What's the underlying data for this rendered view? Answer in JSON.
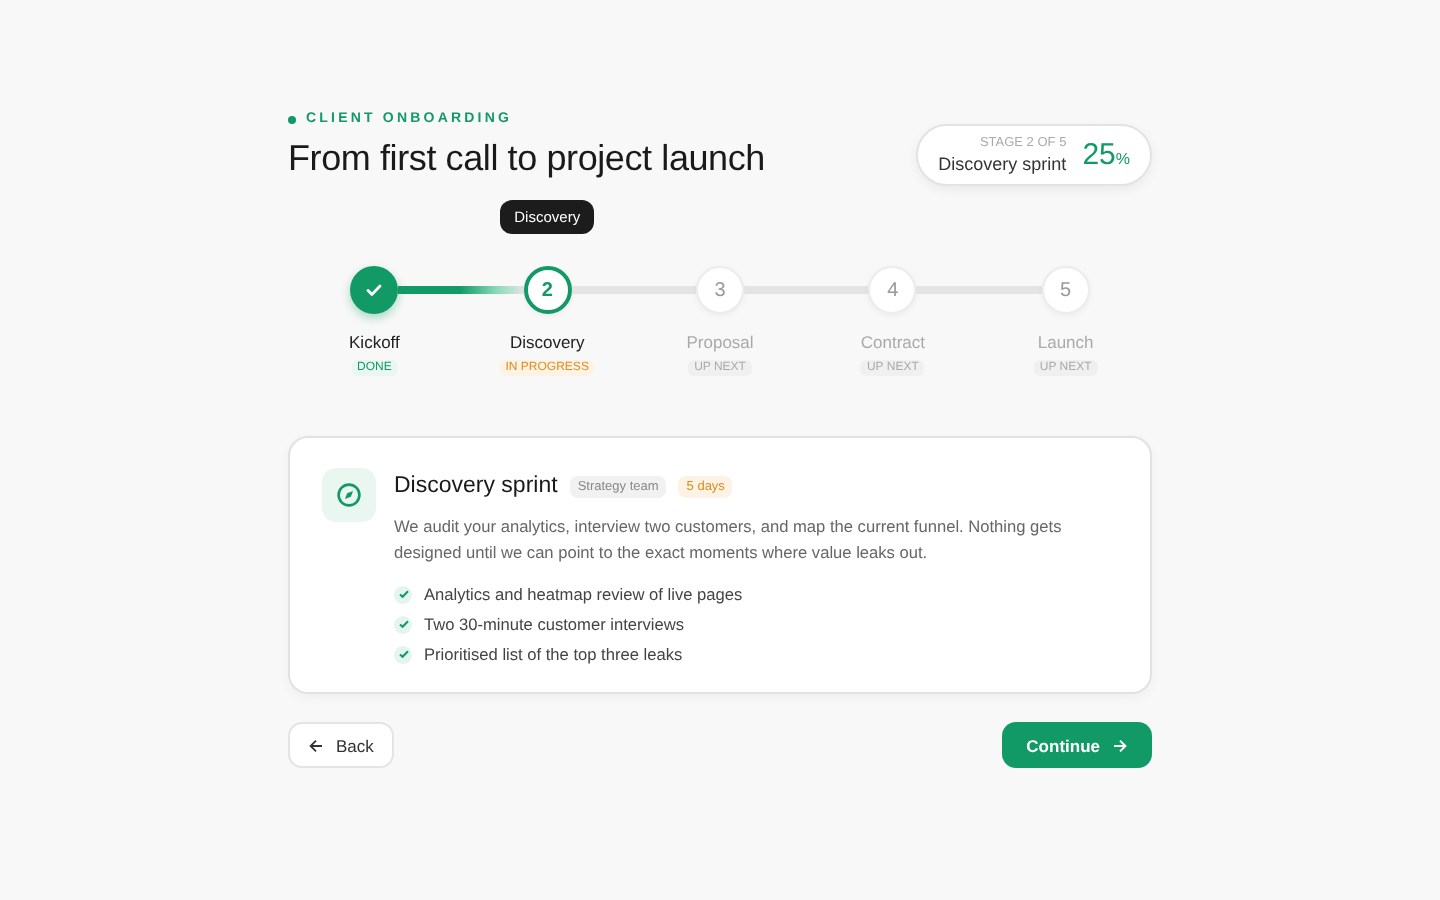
{
  "header": {
    "eyebrow": "CLIENT ONBOARDING",
    "title": "From first call to project launch"
  },
  "stage_card": {
    "label": "STAGE 2 OF 5",
    "name": "Discovery sprint",
    "percent": "25",
    "unit": "%"
  },
  "steps": [
    {
      "label": "Kickoff",
      "status_text": "DONE",
      "kind": "done"
    },
    {
      "number": "2",
      "label": "Discovery",
      "status_text": "IN PROGRESS",
      "kind": "current",
      "tooltip": "Discovery"
    },
    {
      "number": "3",
      "label": "Proposal",
      "status_text": "UP NEXT",
      "kind": "upcoming"
    },
    {
      "number": "4",
      "label": "Contract",
      "status_text": "UP NEXT",
      "kind": "upcoming"
    },
    {
      "number": "5",
      "label": "Launch",
      "status_text": "UP NEXT",
      "kind": "upcoming"
    }
  ],
  "detail_card": {
    "title": "Discovery sprint",
    "tags": [
      {
        "text": "Strategy team",
        "kind": "neutral"
      },
      {
        "text": "5 days",
        "kind": "warning"
      }
    ],
    "description": "We audit your analytics, interview two customers, and map the current funnel. Nothing gets designed until we can point to the exact moments where value leaks out.",
    "checklist": [
      {
        "text": "Analytics and heatmap review of live pages",
        "checked": true
      },
      {
        "text": "Two 30-minute customer interviews",
        "checked": true
      },
      {
        "text": "Prioritised list of the top three leaks",
        "checked": true
      }
    ]
  },
  "buttons": {
    "back": "Back",
    "continue": "Continue"
  }
}
